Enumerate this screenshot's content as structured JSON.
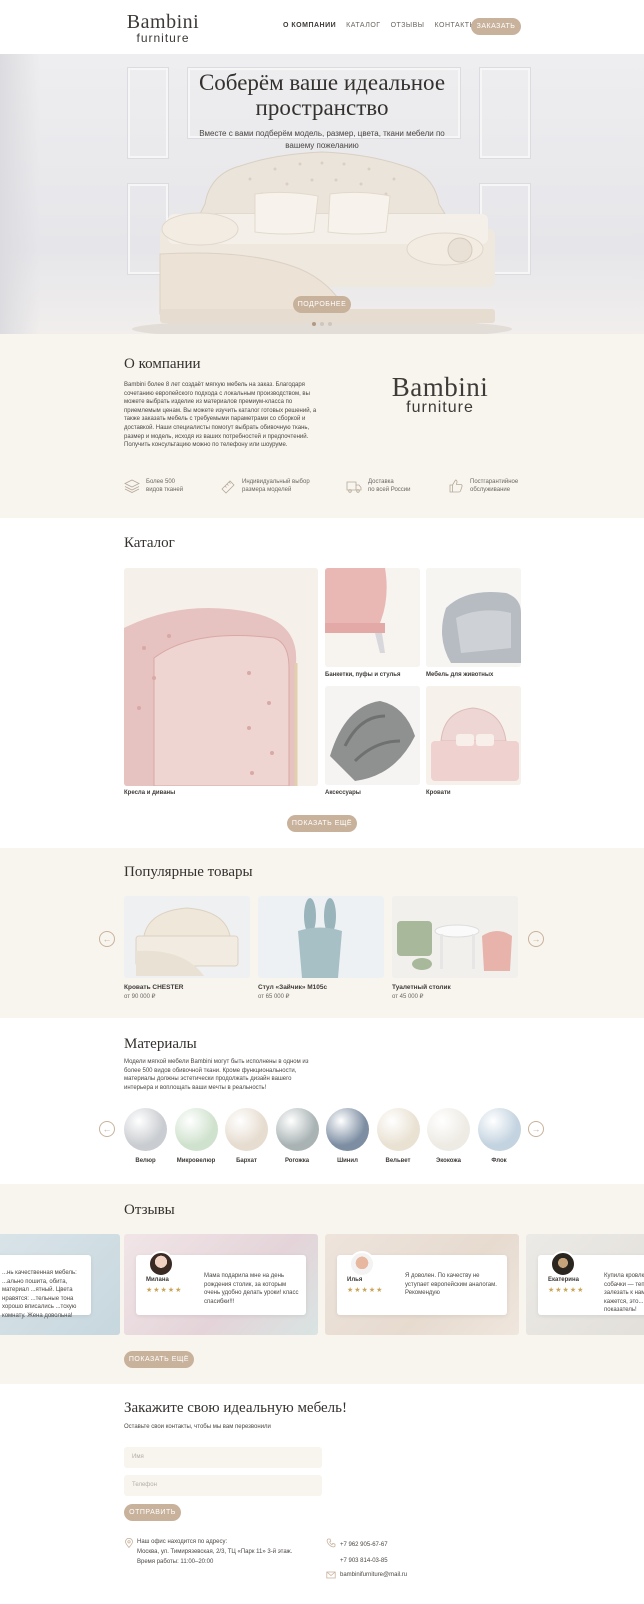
{
  "header": {
    "logo_line1": "Bambini",
    "logo_line2": "furniture",
    "nav": [
      "О компании",
      "Каталог",
      "Отзывы",
      "Контакты"
    ],
    "order_button": "Заказать"
  },
  "hero": {
    "title": "Соберём ваше идеальное пространство",
    "subtitle": "Вместе с вами подберём модель, размер, цвета, ткани мебели по вашему пожеланию",
    "button": "Подробнее",
    "slides": 3,
    "active_slide": 1
  },
  "about": {
    "title": "О компании",
    "text": "Bambini более 8 лет создаёт мягкую мебель на заказ. Благодаря сочетанию европейского подхода с локальным производством, вы можете выбрать изделие из материалов премиум-класса по приемлемым ценам. Вы можете изучить каталог готовых решений, а также заказать мебель с требуемыми параметрами со сборкой и доставкой. Наши специалисты помогут выбрать обивочную ткань, размер и модель, исходя из ваших потребностей и предпочтений. Получить консультацию можно по телефону или шоуруме.",
    "logo_line1": "Bambini",
    "logo_line2": "furniture",
    "features": [
      {
        "icon": "layers-icon",
        "line1": "Более 500",
        "line2": "видов тканей"
      },
      {
        "icon": "ruler-icon",
        "line1": "Индивидуальный выбор",
        "line2": "размера моделей"
      },
      {
        "icon": "truck-icon",
        "line1": "Доставка",
        "line2": "по всей России"
      },
      {
        "icon": "thumbs-up-icon",
        "line1": "Постгарантийное",
        "line2": "обслуживание"
      }
    ]
  },
  "catalog": {
    "title": "Каталог",
    "items": [
      "Кресла и диваны",
      "Банкетки, пуфы и стулья",
      "Мебель для животных",
      "Аксессуары",
      "Кровати"
    ],
    "button": "Показать ещё"
  },
  "popular": {
    "title": "Популярные товары",
    "products": [
      {
        "name": "Кровать CHESTER",
        "price": "от 90 000 ₽"
      },
      {
        "name": "Стул «Зайчик» M105c",
        "price": "от 65 000 ₽"
      },
      {
        "name": "Туалетный столик",
        "price": "от 45 000 ₽"
      }
    ]
  },
  "materials": {
    "title": "Материалы",
    "text": "Модели мягкой мебели Bambini могут быть исполнены в одном из более 500 видов обивочной ткани. Кроме функциональности, материалы должны эстетически продолжать дизайн вашего интерьера и воплощать ваши мечты в реальность!",
    "items": [
      {
        "name": "Велюр",
        "color": "#c9ccd0"
      },
      {
        "name": "Микровелюр",
        "color": "#cfe2cd"
      },
      {
        "name": "Бархат",
        "color": "#e6dccf"
      },
      {
        "name": "Рогожка",
        "color": "#a9b3b4"
      },
      {
        "name": "Шинил",
        "color": "#7d8ea3"
      },
      {
        "name": "Вельвет",
        "color": "#e9e1d2"
      },
      {
        "name": "Экокожа",
        "color": "#eeebe4"
      },
      {
        "name": "Флок",
        "color": "#c3d3e0"
      }
    ]
  },
  "reviews": {
    "title": "Отзывы",
    "items": [
      {
        "name": "",
        "text": "...нь качественная мебель: ...ально пошита, обита, материал ...ятный. Цвета нравятся: ...тельные тона хорошо вписались ...тскую комнату. Жена довольна!"
      },
      {
        "name": "Милана",
        "text": "Мама подарила мне на день рождения столик, за которым очень удобно делать уроки! класс спасибки!!!"
      },
      {
        "name": "Илья",
        "text": "Я доволен. По качеству не уступает европейским аналогам. Рекомендую"
      },
      {
        "name": "Екатерина",
        "text": "Купила кровлку ... собачки — тепер... залезать к нам в к... Мне кажется, это... показатель!"
      }
    ],
    "stars": "★★★★★",
    "button": "Показать ещё"
  },
  "order": {
    "title": "Закажите свою идеальную мебель!",
    "subtitle": "Оставьте свои контакты, чтобы мы вам перезвонили",
    "name_placeholder": "Имя",
    "phone_placeholder": "Телефон",
    "button": "Отправить",
    "address_line1": "Наш офис находится по адресу:",
    "address_line2": "Москва, ул. Тимирязевская, 2/3, ТЦ «Парк 11» 3-й этаж.",
    "hours": "Время работы: 11:00–20:00",
    "phone1": "+7 962 905-67-67",
    "phone2": "+7 903 814-03-85",
    "email": "bambinifurniture@mail.ru"
  },
  "colors": {
    "accent": "#c8b29c",
    "beige_bg": "#f8f5ef",
    "text": "#3d3a37"
  }
}
